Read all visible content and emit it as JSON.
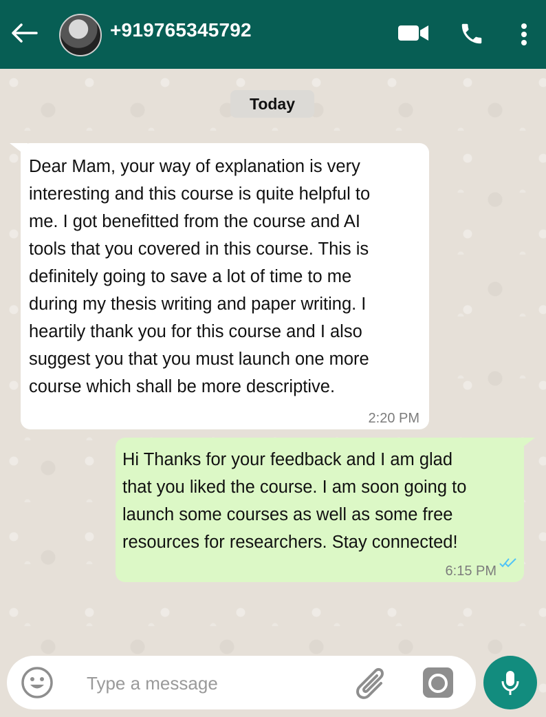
{
  "header": {
    "contact": "+919765345792",
    "color": "#075e54"
  },
  "chat": {
    "date_label": "Today",
    "messages": [
      {
        "direction": "incoming",
        "text": "Dear Mam, your way of explanation is very\ninteresting and this course is quite helpful to\nme. I got benefitted from the course and AI\ntools that you covered in this course. This is\ndefinitely going to save a lot of time to me\nduring my thesis writing and paper writing. I\nheartily thank you for this course and I also\nsuggest you that you must launch one more\ncourse which shall be more descriptive.",
        "time": "2:20 PM"
      },
      {
        "direction": "outgoing",
        "text": "Hi Thanks for your feedback and I am glad\nthat you liked the course. I am soon going to\nlaunch some courses as well as some free\nresources for researchers. Stay connected!",
        "time": "6:15 PM",
        "status_icon": "double-check-icon",
        "status_color": "#4fc3f7"
      }
    ]
  },
  "composer": {
    "placeholder": "Type a message",
    "icons": [
      "emoji-icon",
      "paperclip-icon",
      "camera-icon",
      "microphone-icon"
    ],
    "send_button_color": "#128c7e"
  }
}
